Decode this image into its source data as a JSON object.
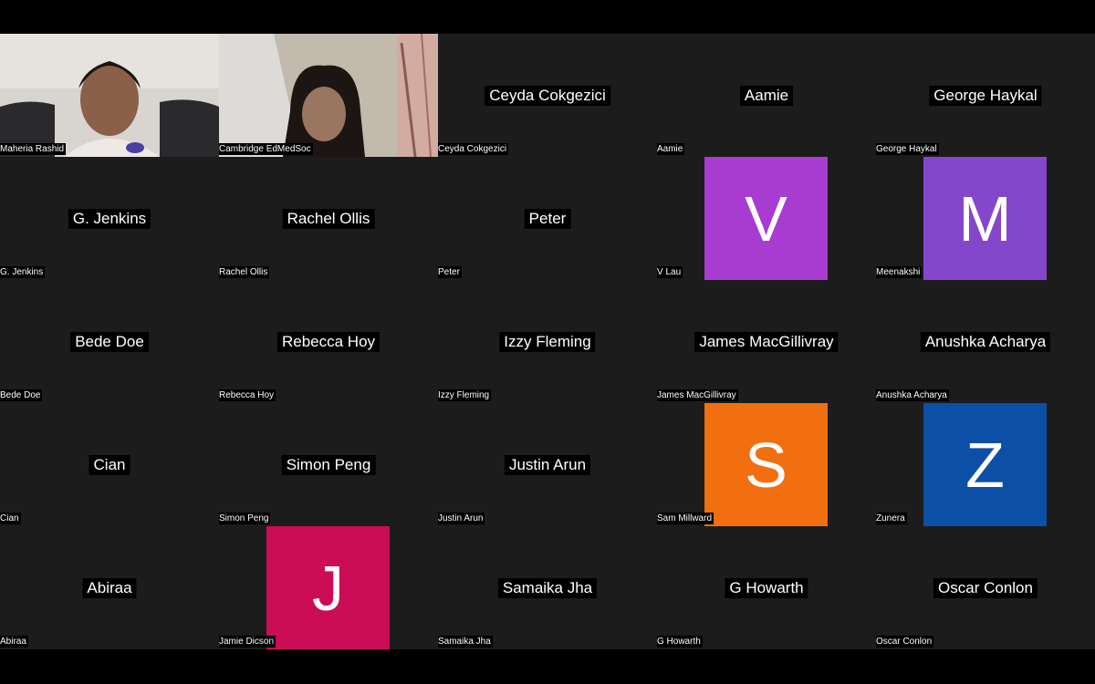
{
  "participants": [
    {
      "label": "Maheria Rashid",
      "type": "video"
    },
    {
      "label": "Cambridge EdMedSoc",
      "type": "video"
    },
    {
      "label": "Ceyda Cokgezici",
      "center": "Ceyda Cokgezici",
      "type": "name"
    },
    {
      "label": "Aamie",
      "center": "Aamie",
      "type": "name"
    },
    {
      "label": "George Haykal",
      "center": "George Haykal",
      "type": "name"
    },
    {
      "label": "G. Jenkins",
      "center": "G. Jenkins",
      "type": "name"
    },
    {
      "label": "Rachel Ollis",
      "center": "Rachel Ollis",
      "type": "name"
    },
    {
      "label": "Peter",
      "center": "Peter",
      "type": "name"
    },
    {
      "label": "V Lau",
      "initial": "V",
      "color": "#a83cd1",
      "type": "avatar"
    },
    {
      "label": "Meenakshi",
      "initial": "M",
      "color": "#8447cc",
      "type": "avatar"
    },
    {
      "label": "Bede Doe",
      "center": "Bede Doe",
      "type": "name"
    },
    {
      "label": "Rebecca Hoy",
      "center": "Rebecca Hoy",
      "type": "name"
    },
    {
      "label": "Izzy Fleming",
      "center": "Izzy Fleming",
      "type": "name"
    },
    {
      "label": "James MacGillivray",
      "center": "James MacGillivray",
      "type": "name"
    },
    {
      "label": "Anushka Acharya",
      "center": "Anushka Acharya",
      "type": "name"
    },
    {
      "label": "Cian",
      "center": "Cian",
      "type": "name"
    },
    {
      "label": "Simon Peng",
      "center": "Simon Peng",
      "type": "name"
    },
    {
      "label": "Justin Arun",
      "center": "Justin Arun",
      "type": "name"
    },
    {
      "label": "Sam Millward",
      "initial": "S",
      "color": "#f26f0f",
      "type": "avatar"
    },
    {
      "label": "Zunera",
      "initial": "Z",
      "color": "#0b4fa6",
      "type": "avatar"
    },
    {
      "label": "Abiraa",
      "center": "Abiraa",
      "type": "name"
    },
    {
      "label": "Jamie Dicson",
      "initial": "J",
      "color": "#cb0d56",
      "type": "avatar"
    },
    {
      "label": "Samaika Jha",
      "center": "Samaika Jha",
      "type": "name"
    },
    {
      "label": "G Howarth",
      "center": "G Howarth",
      "type": "name"
    },
    {
      "label": "Oscar Conlon",
      "center": "Oscar Conlon",
      "type": "name"
    }
  ]
}
